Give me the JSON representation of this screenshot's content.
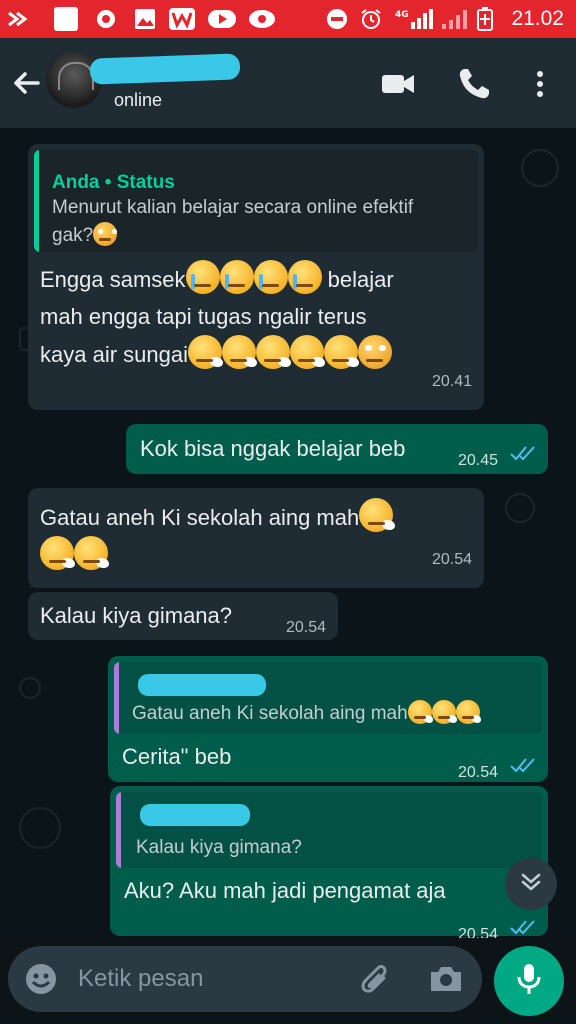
{
  "status_bar": {
    "time": "21.02",
    "network": "4G"
  },
  "header": {
    "subtitle": "online"
  },
  "messages": [
    {
      "quote_title": "Anda • Status",
      "quote_text": "Menurut kalian belajar secara online efektif gak?",
      "text_1": "Engga samsek",
      "text_2": " belajar",
      "text_3": "mah engga tapi tugas ngalir terus",
      "text_4": "kaya air sungai",
      "time": "20.41"
    },
    {
      "text": "Kok bisa nggak belajar beb",
      "time": "20.45"
    },
    {
      "text": "Gatau aneh Ki sekolah aing mah",
      "time": "20.54"
    },
    {
      "text": "Kalau kiya gimana?",
      "time": "20.54"
    },
    {
      "quote_text": "Gatau aneh Ki sekolah aing mah",
      "text": "Cerita\" beb",
      "time": "20.54"
    },
    {
      "quote_text": "Kalau kiya gimana?",
      "text": "Aku? Aku mah jadi pengamat aja",
      "time": "20.54"
    }
  ],
  "input": {
    "placeholder": "Ketik pesan"
  },
  "colors": {
    "status_bar": "#e3262e",
    "header": "#1f2c34",
    "incoming": "#202c33",
    "outgoing": "#005c4b",
    "accent": "#00a884",
    "read_ticks": "#53bdeb",
    "redaction": "#39c8e8"
  },
  "icons": [
    "back-arrow-icon",
    "video-call-icon",
    "phone-icon",
    "more-menu-icon",
    "emoji-icon",
    "attach-icon",
    "camera-icon",
    "mic-icon",
    "scroll-down-icon",
    "read-ticks-icon"
  ]
}
